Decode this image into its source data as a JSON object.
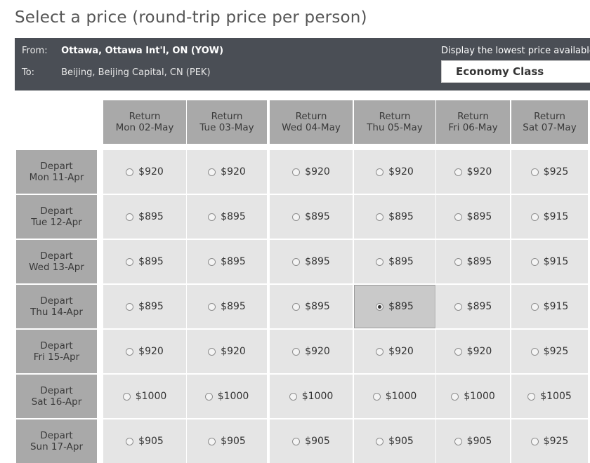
{
  "title": "Select a price (round-trip price per person)",
  "route": {
    "from_label": "From:",
    "from_value": "Ottawa, Ottawa Int'l, ON (YOW)",
    "to_label": "To:",
    "to_value": "Beijing, Beijing Capital, CN (PEK)",
    "lowest_label": "Display the lowest price available",
    "class_value": "Economy Class"
  },
  "return_headers": [
    {
      "top": "Return",
      "date": "Mon 02-May"
    },
    {
      "top": "Return",
      "date": "Tue 03-May"
    },
    {
      "top": "Return",
      "date": "Wed 04-May"
    },
    {
      "top": "Return",
      "date": "Thu 05-May"
    },
    {
      "top": "Return",
      "date": "Fri 06-May"
    },
    {
      "top": "Return",
      "date": "Sat 07-May"
    }
  ],
  "depart_headers": [
    {
      "top": "Depart",
      "date": "Mon 11-Apr"
    },
    {
      "top": "Depart",
      "date": "Tue 12-Apr"
    },
    {
      "top": "Depart",
      "date": "Wed 13-Apr"
    },
    {
      "top": "Depart",
      "date": "Thu 14-Apr"
    },
    {
      "top": "Depart",
      "date": "Fri 15-Apr"
    },
    {
      "top": "Depart",
      "date": "Sat 16-Apr"
    },
    {
      "top": "Depart",
      "date": "Sun 17-Apr"
    }
  ],
  "prices": [
    [
      "$920",
      "$920",
      "$920",
      "$920",
      "$920",
      "$925"
    ],
    [
      "$895",
      "$895",
      "$895",
      "$895",
      "$895",
      "$915"
    ],
    [
      "$895",
      "$895",
      "$895",
      "$895",
      "$895",
      "$915"
    ],
    [
      "$895",
      "$895",
      "$895",
      "$895",
      "$895",
      "$915"
    ],
    [
      "$920",
      "$920",
      "$920",
      "$920",
      "$920",
      "$925"
    ],
    [
      "$1000",
      "$1000",
      "$1000",
      "$1000",
      "$1000",
      "$1005"
    ],
    [
      "$905",
      "$905",
      "$905",
      "$905",
      "$905",
      "$925"
    ]
  ],
  "selected": {
    "row": 3,
    "col": 3
  }
}
